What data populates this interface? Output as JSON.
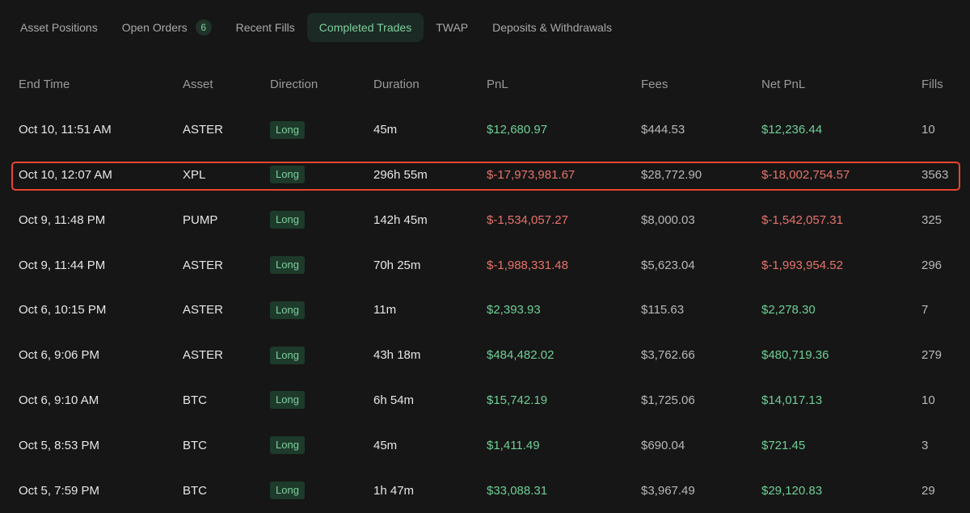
{
  "tabs": [
    {
      "label": "Asset Positions"
    },
    {
      "label": "Open Orders",
      "badge": "6"
    },
    {
      "label": "Recent Fills"
    },
    {
      "label": "Completed Trades",
      "active": true
    },
    {
      "label": "TWAP"
    },
    {
      "label": "Deposits & Withdrawals"
    }
  ],
  "table": {
    "headers": [
      "End Time",
      "Asset",
      "Direction",
      "Duration",
      "PnL",
      "Fees",
      "Net PnL",
      "Fills"
    ],
    "rows": [
      {
        "end_time": "Oct 10, 11:51 AM",
        "asset": "ASTER",
        "direction": "Long",
        "duration": "45m",
        "pnl": "$12,680.97",
        "pnl_sign": "pos",
        "fees": "$444.53",
        "net_pnl": "$12,236.44",
        "net_sign": "pos",
        "fills": "10"
      },
      {
        "end_time": "Oct 10, 12:07 AM",
        "asset": "XPL",
        "direction": "Long",
        "duration": "296h 55m",
        "pnl": "$-17,973,981.67",
        "pnl_sign": "neg",
        "fees": "$28,772.90",
        "net_pnl": "$-18,002,754.57",
        "net_sign": "neg",
        "fills": "3563",
        "highlighted": true
      },
      {
        "end_time": "Oct 9, 11:48 PM",
        "asset": "PUMP",
        "direction": "Long",
        "duration": "142h 45m",
        "pnl": "$-1,534,057.27",
        "pnl_sign": "neg",
        "fees": "$8,000.03",
        "net_pnl": "$-1,542,057.31",
        "net_sign": "neg",
        "fills": "325"
      },
      {
        "end_time": "Oct 9, 11:44 PM",
        "asset": "ASTER",
        "direction": "Long",
        "duration": "70h 25m",
        "pnl": "$-1,988,331.48",
        "pnl_sign": "neg",
        "fees": "$5,623.04",
        "net_pnl": "$-1,993,954.52",
        "net_sign": "neg",
        "fills": "296"
      },
      {
        "end_time": "Oct 6, 10:15 PM",
        "asset": "ASTER",
        "direction": "Long",
        "duration": "11m",
        "pnl": "$2,393.93",
        "pnl_sign": "pos",
        "fees": "$115.63",
        "net_pnl": "$2,278.30",
        "net_sign": "pos",
        "fills": "7"
      },
      {
        "end_time": "Oct 6, 9:06 PM",
        "asset": "ASTER",
        "direction": "Long",
        "duration": "43h 18m",
        "pnl": "$484,482.02",
        "pnl_sign": "pos",
        "fees": "$3,762.66",
        "net_pnl": "$480,719.36",
        "net_sign": "pos",
        "fills": "279"
      },
      {
        "end_time": "Oct 6, 9:10 AM",
        "asset": "BTC",
        "direction": "Long",
        "duration": "6h 54m",
        "pnl": "$15,742.19",
        "pnl_sign": "pos",
        "fees": "$1,725.06",
        "net_pnl": "$14,017.13",
        "net_sign": "pos",
        "fills": "10"
      },
      {
        "end_time": "Oct 5, 8:53 PM",
        "asset": "BTC",
        "direction": "Long",
        "duration": "45m",
        "pnl": "$1,411.49",
        "pnl_sign": "pos",
        "fees": "$690.04",
        "net_pnl": "$721.45",
        "net_sign": "pos",
        "fills": "3"
      },
      {
        "end_time": "Oct 5, 7:59 PM",
        "asset": "BTC",
        "direction": "Long",
        "duration": "1h 47m",
        "pnl": "$33,088.31",
        "pnl_sign": "pos",
        "fees": "$3,967.49",
        "net_pnl": "$29,120.83",
        "net_sign": "pos",
        "fills": "29"
      }
    ]
  },
  "colors": {
    "positive": "#6fcf97",
    "negative": "#e5736b",
    "highlight": "#e8452f",
    "accent": "#7fcf9f"
  }
}
